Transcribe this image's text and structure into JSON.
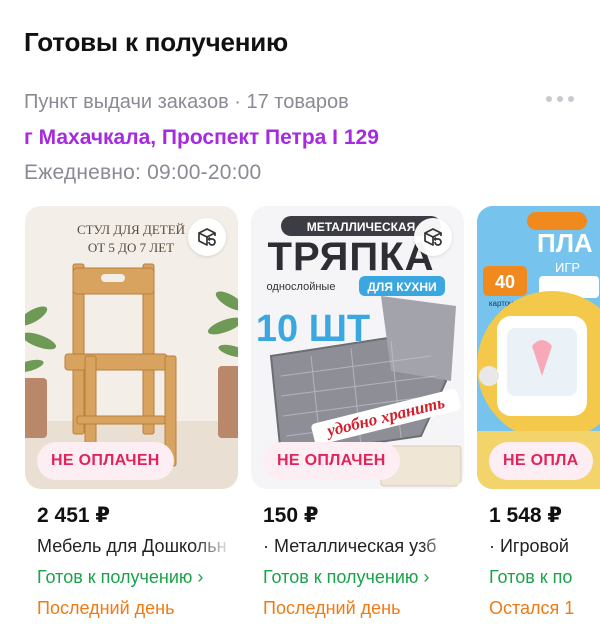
{
  "section": {
    "title": "Готовы к получению",
    "meta": "Пункт выдачи заказов · 17 товаров",
    "address": "г Махачкала, Проспект Петра I 129",
    "hours": "Ежедневно: 09:00-20:00"
  },
  "colors": {
    "accent": "#a52ae0",
    "ready": "#19a34a",
    "deadline": "#f07a13",
    "unpaid": "#e0245e"
  },
  "products": [
    {
      "image_text_1": "СТУЛ ДЛЯ ДЕТЕЙ",
      "image_text_2": "ОТ 5 ДО 7 ЛЕТ",
      "status": "НЕ ОПЛАЧЕН",
      "price": "2 451 ₽",
      "name": "Мебель для Дошкольн",
      "ready": "Готов к получению ›",
      "deadline": "Последний день",
      "icon": "return-box-icon"
    },
    {
      "image_text_1": "МЕТАЛЛИЧЕСКАЯ",
      "image_text_2": "ТРЯПКА",
      "image_text_3": "однослойные",
      "image_text_4": "ДЛЯ КУХНИ",
      "image_text_5": "10 ШТ",
      "image_text_6": "удобно хранить",
      "status": "НЕ ОПЛАЧЕН",
      "price": "150 ₽",
      "name": "· Металлическая узб",
      "ready": "Готов к получению ›",
      "deadline": "Последний день",
      "icon": "return-box-icon"
    },
    {
      "image_text_1": "ПЛА",
      "image_text_2": "ИГР",
      "image_text_3": "40",
      "image_text_4": "карточек",
      "status": "НЕ ОПЛА",
      "price": "1 548 ₽",
      "name": "· Игровой",
      "ready": "Готов к по",
      "deadline": "Остался 1"
    }
  ]
}
